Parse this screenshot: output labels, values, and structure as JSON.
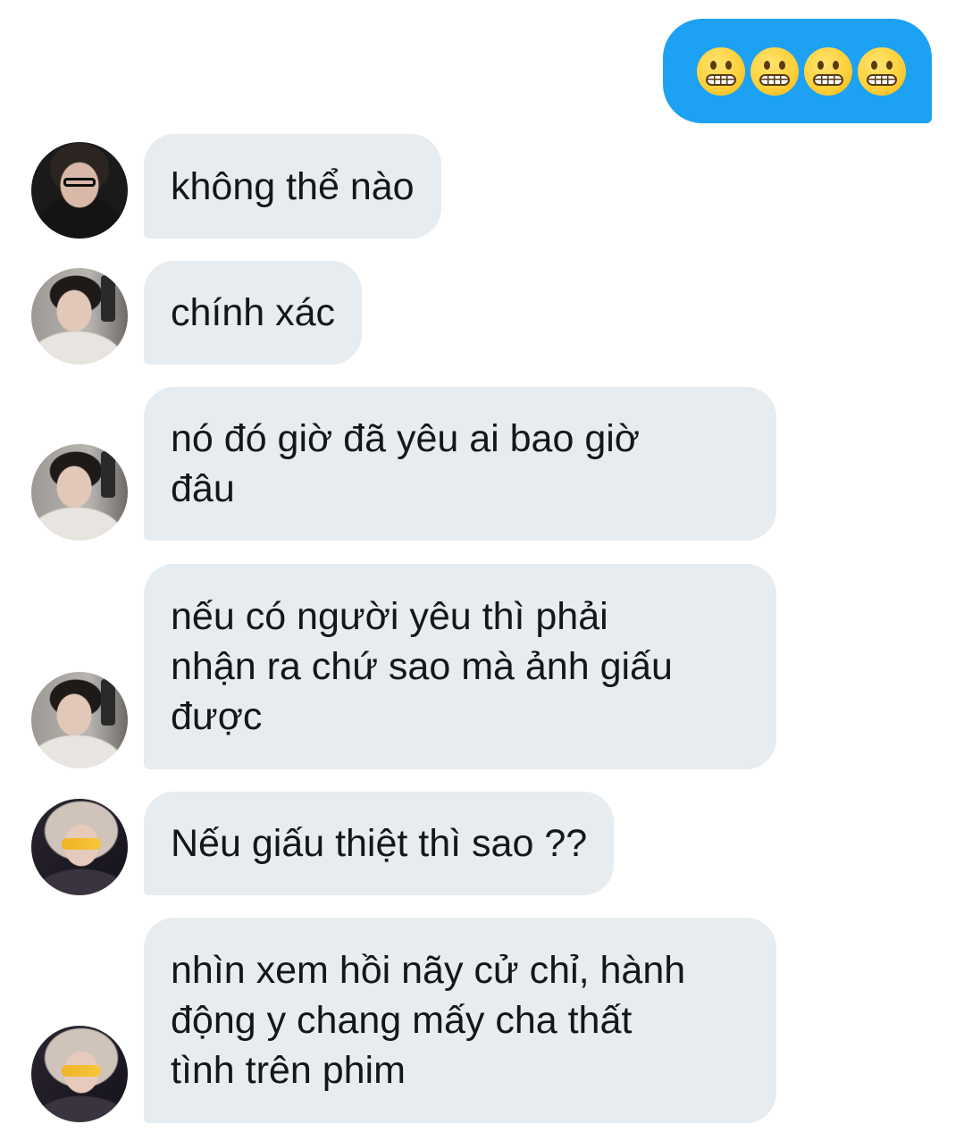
{
  "sent_message": {
    "emojis": [
      "grimacing-face",
      "grimacing-face",
      "grimacing-face",
      "grimacing-face"
    ],
    "bubble_color": "#1da1f2"
  },
  "received_bubble_color": "#e6ecf0",
  "messages": [
    {
      "avatar": "avatar-a",
      "text": "không thể nào"
    },
    {
      "avatar": "avatar-b",
      "text": "chính xác"
    },
    {
      "avatar": "avatar-b",
      "text": "nó đó giờ đã yêu ai bao giờ\nđâu"
    },
    {
      "avatar": "avatar-b",
      "text": "nếu có người yêu thì phải\nnhận ra chứ sao mà ảnh giấu\nđược"
    },
    {
      "avatar": "avatar-c",
      "text": "Nếu giấu thiệt thì sao ??"
    },
    {
      "avatar": "avatar-c",
      "text": "nhìn xem hồi nãy cử chỉ, hành\nđộng y chang mấy cha thất\ntình trên phim"
    }
  ]
}
